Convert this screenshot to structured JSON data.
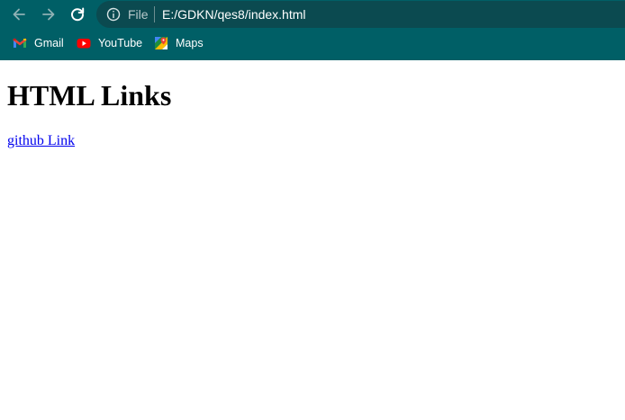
{
  "browser": {
    "nav": {
      "back_icon": "arrow-left-icon",
      "forward_icon": "arrow-right-icon",
      "reload_icon": "reload-icon"
    },
    "omnibox": {
      "info_icon": "info-circle-icon",
      "scheme_label": "File",
      "url": "E:/GDKN/qes8/index.html"
    },
    "bookmarks": [
      {
        "label": "Gmail",
        "icon": "gmail-icon"
      },
      {
        "label": "YouTube",
        "icon": "youtube-icon"
      },
      {
        "label": "Maps",
        "icon": "maps-icon"
      }
    ],
    "colors": {
      "frame": "#005f66",
      "omnibox": "#0b4a50"
    }
  },
  "page": {
    "heading": "HTML Links",
    "link_text": "github Link",
    "link_color": "#0000ee"
  }
}
